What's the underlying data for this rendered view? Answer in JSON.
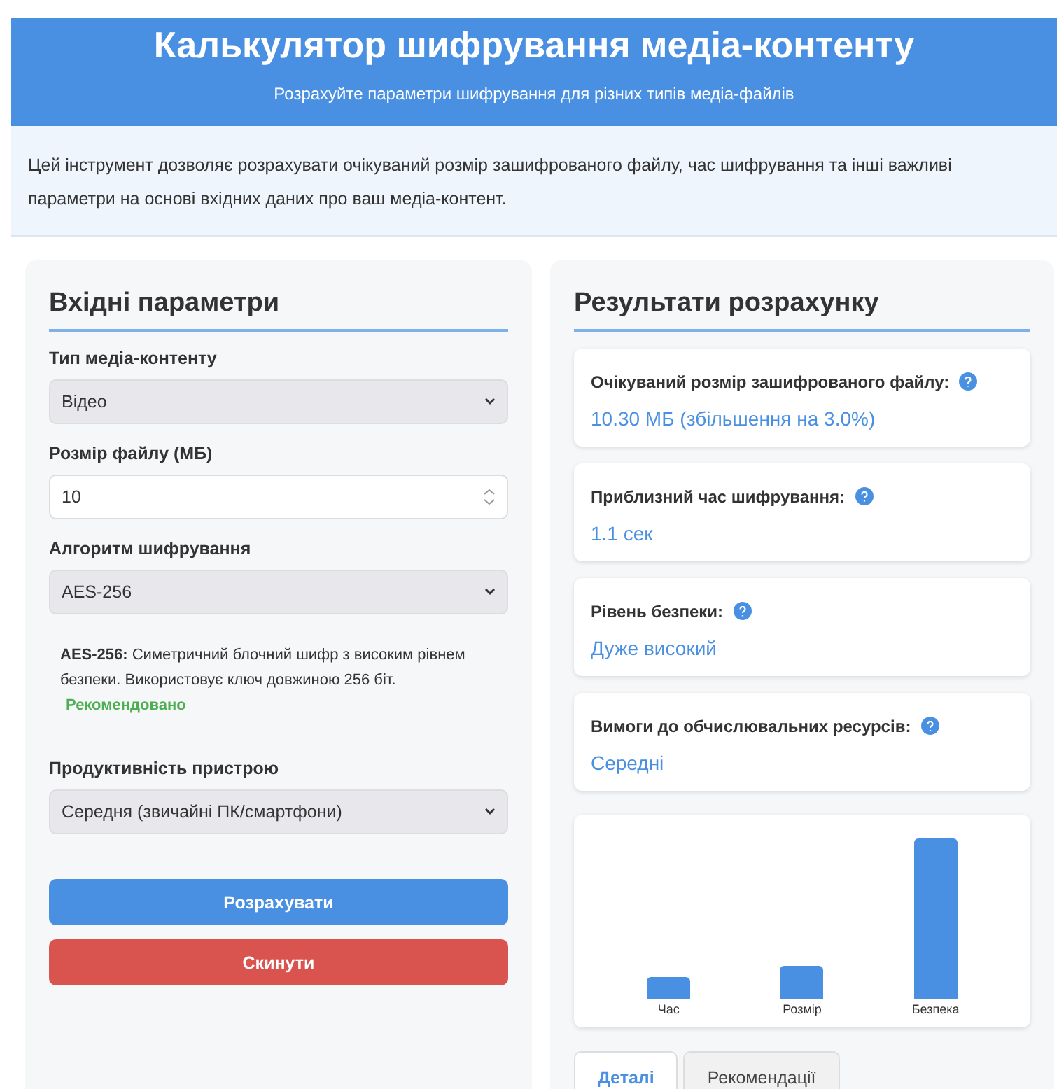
{
  "header": {
    "title": "Калькулятор шифрування медіа-контенту",
    "subtitle": "Розрахуйте параметри шифрування для різних типів медіа-файлів"
  },
  "intro": "Цей інструмент дозволяє розрахувати очікуваний розмір зашифрованого файлу, час шифрування та інші важливі параметри на основі вхідних даних про ваш медіа-контент.",
  "inputs": {
    "title": "Вхідні параметри",
    "fields": [
      {
        "kind": "select",
        "label": "Тип медіа-контенту",
        "value": "Відео"
      },
      {
        "kind": "number",
        "label": "Розмір файлу (МБ)",
        "value": "10"
      },
      {
        "kind": "select",
        "label": "Алгоритм шифрування",
        "value": "AES-256"
      },
      {
        "kind": "note",
        "text": "**AES-256:** Симетричний блочний шифр з високим рівнем безпеки. Використовує ключ довжиною 256 біт.",
        "badge": "Рекомендовано"
      },
      {
        "kind": "select",
        "label": "Продуктивність пристрою",
        "value": "Середня (звичайні ПК/смартфони)"
      }
    ],
    "buttons": [
      {
        "kind": "primary",
        "label": "Розрахувати"
      },
      {
        "kind": "danger",
        "label": "Скинути"
      }
    ]
  },
  "results": {
    "title": "Результати розрахунку",
    "cards": [
      {
        "label": "Очікуваний розмір зашифрованого файлу:",
        "value": "10.30 МБ (збільшення на 3.0%)"
      },
      {
        "label": "Приблизний час шифрування:",
        "value": "1.1 сек"
      },
      {
        "label": "Рівень безпеки:",
        "value": "Дуже високий"
      },
      {
        "label": "Вимоги до обчислювальних ресурсів:",
        "value": "Середні"
      }
    ],
    "chart": {
      "labels": [
        "Час",
        "Розмір",
        "Безпека"
      ]
    },
    "tabs": [
      {
        "label": "Деталі",
        "selected": true
      },
      {
        "label": "Рекомендації",
        "selected": false
      }
    ]
  }
}
